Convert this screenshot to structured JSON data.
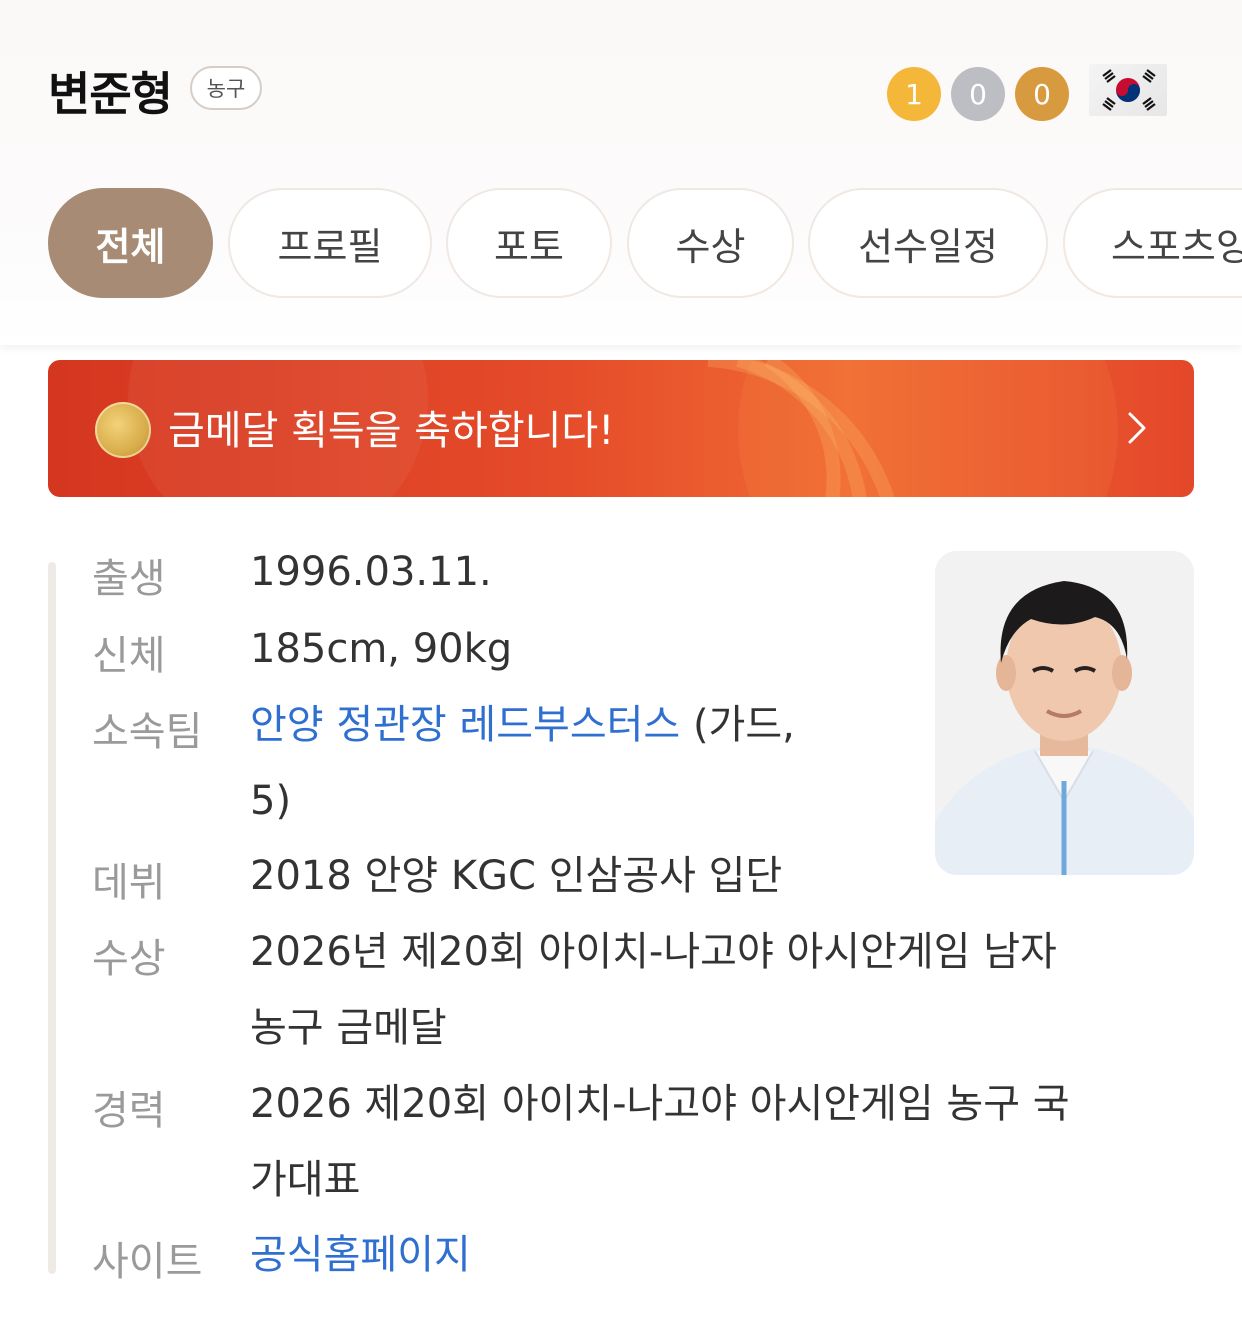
{
  "header": {
    "athlete_name": "변준형",
    "sport_badge": "농구",
    "medals": {
      "gold": "1",
      "silver": "0",
      "bronze": "0"
    },
    "flag_icon": "south-korea-flag-icon"
  },
  "tabs": [
    {
      "label": "전체",
      "active": true
    },
    {
      "label": "프로필"
    },
    {
      "label": "포토"
    },
    {
      "label": "수상"
    },
    {
      "label": "선수일정"
    },
    {
      "label": "스포츠잉"
    }
  ],
  "banner": {
    "text": "금메달 획득을 축하합니다!",
    "icon": "gold-medal-icon",
    "arrow_icon": "chevron-right-icon"
  },
  "profile": {
    "birth_label": "출생",
    "birth_value": "1996.03.11.",
    "body_label": "신체",
    "body_value": "185cm, 90kg",
    "team_label": "소속팀",
    "team_link": "안양 정관장 레드부스터스",
    "team_suffix_1": " (가드,",
    "team_suffix_2": "5)",
    "debut_label": "데뷔",
    "debut_value": "2018 안양 KGC 인삼공사 입단",
    "award_label": "수상",
    "award_value_1": "2026년 제20회 아이치-나고야 아시안게임 남자",
    "award_value_2": "농구 금메달",
    "career_label": "경력",
    "career_value_1": "2026 제20회 아이치-나고야 아시안게임 농구 국",
    "career_value_2": "가대표",
    "site_label": "사이트",
    "site_link": "공식홈페이지"
  },
  "colors": {
    "accent_tab": "#a78b74",
    "banner_red": "#e54c2a",
    "link_blue": "#2f6fd0",
    "gold": "#f4b73a",
    "silver": "#bdbec3",
    "bronze": "#d89a3e"
  }
}
